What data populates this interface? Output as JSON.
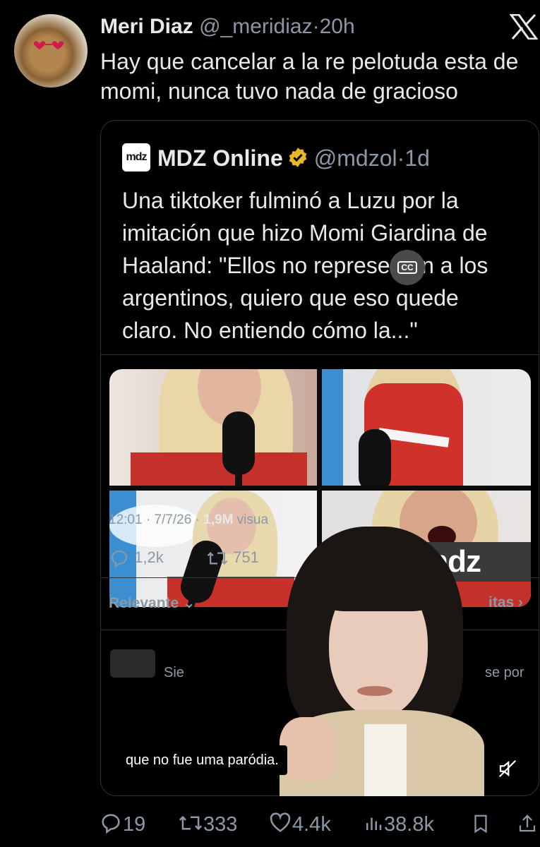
{
  "tweet": {
    "author_name": "Meri Diaz",
    "author_handle": "@_meridiaz",
    "separator": "·",
    "time": "20h",
    "text": "Hay que cancelar a la re pelotuda esta de momi, nunca tuvo nada de gracioso"
  },
  "quote": {
    "logo_text": "mdz",
    "author_name": "MDZ Online",
    "author_handle": "@mdzol",
    "separator": "·",
    "time": "1d",
    "text": "Una tiktoker fulminó a Luzu por la imitación que hizo Momi Giardina de Haaland: \"Ellos no representan a los argentinos, quiero que eso quede claro. No entiendo cómo la...\""
  },
  "video": {
    "cc_label": "CC",
    "watermark": "mdz",
    "caption": "que no fue uma paródia.",
    "inner_meta_time": "12:01 · 7/7/26 · ",
    "inner_meta_views": "1,9M",
    "inner_meta_views_label": " visua",
    "inner_replies": "1,2k",
    "inner_retweets": "751",
    "inner_relevante": "Relevante ⌄",
    "inner_citas": "itas ›",
    "inner_sie": "Sie",
    "inner_sepor": "se por"
  },
  "actions": {
    "replies": "19",
    "retweets": "333",
    "likes": "4.4k",
    "views": "38.8k"
  },
  "colors": {
    "background": "#000000",
    "text_primary": "#e7e9ea",
    "text_secondary": "#8b98a5",
    "border": "#2f3336",
    "verified_badge": "#e8b629"
  }
}
